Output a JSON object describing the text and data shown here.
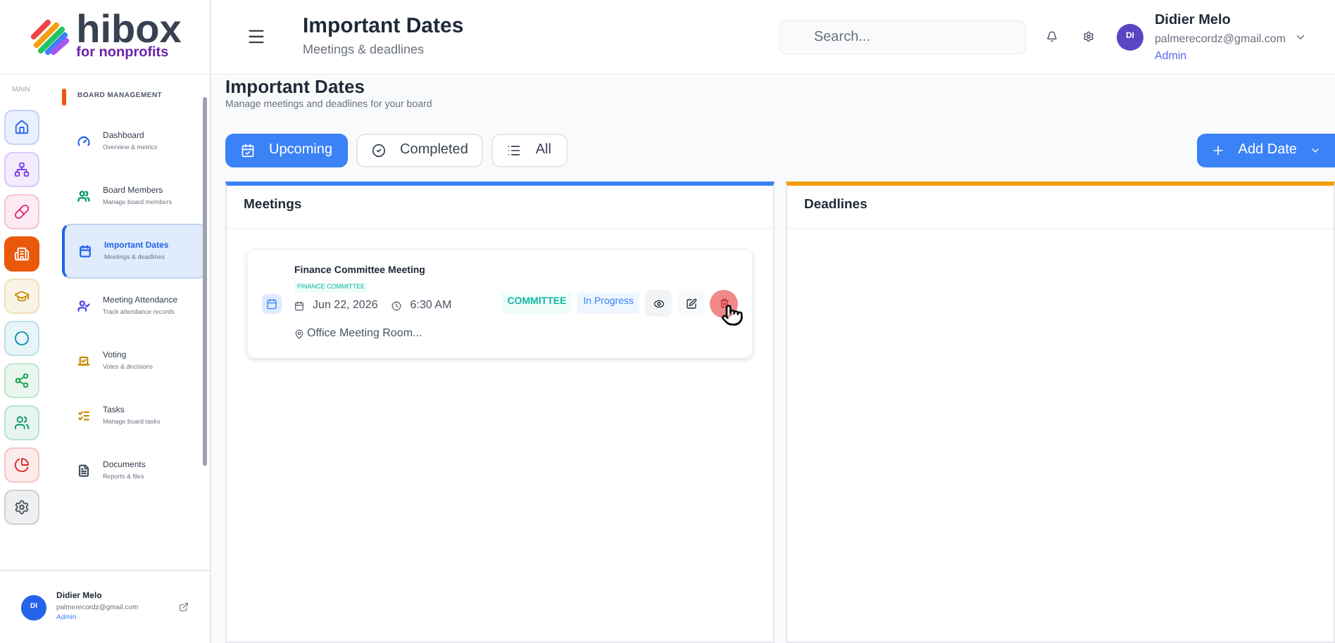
{
  "logo": {
    "name": "hibox",
    "tagline": "for nonprofits"
  },
  "header": {
    "title": "Important Dates",
    "subtitle": "Meetings & deadlines",
    "search": {
      "placeholder": "Search..."
    },
    "user": {
      "initials": "DI",
      "name": "Didier Melo",
      "email": "palmerecordz@gmail.com",
      "role": "Admin"
    }
  },
  "rail": {
    "label": "MAIN",
    "items": [
      {
        "color": "#2563eb",
        "selected": false
      },
      {
        "color": "#7c3aed",
        "selected": false
      },
      {
        "color": "#db2777",
        "selected": false
      },
      {
        "color": "#ea580c",
        "selected": true
      },
      {
        "color": "#ca8a04",
        "selected": false
      },
      {
        "color": "#0891b2",
        "selected": false
      },
      {
        "color": "#16a34a",
        "selected": false
      },
      {
        "color": "#059669",
        "selected": false
      },
      {
        "color": "#dc2626",
        "selected": false
      },
      {
        "color": "#4b5563",
        "selected": false
      }
    ]
  },
  "nav": {
    "section": "BOARD MANAGEMENT",
    "items": [
      {
        "title": "Dashboard",
        "subtitle": "Overview & metrics",
        "color": "#2563eb",
        "selected": false
      },
      {
        "title": "Board Members",
        "subtitle": "Manage board members",
        "color": "#059669",
        "selected": false
      },
      {
        "title": "Important Dates",
        "subtitle": "Meetings & deadlines",
        "color": "#2563eb",
        "selected": true
      },
      {
        "title": "Meeting Attendance",
        "subtitle": "Track attendance records",
        "color": "#4f46e5",
        "selected": false
      },
      {
        "title": "Voting",
        "subtitle": "Votes & decisions",
        "color": "#ca8a04",
        "selected": false
      },
      {
        "title": "Tasks",
        "subtitle": "Manage board tasks",
        "color": "#ca8a04",
        "selected": false
      },
      {
        "title": "Documents",
        "subtitle": "Reports & files",
        "color": "#4b5563",
        "selected": false
      }
    ]
  },
  "sidebar_user": {
    "initials": "DI",
    "name": "Didier Melo",
    "email": "palmerecordz@gmail.com",
    "role": "Admin"
  },
  "page": {
    "title": "Important Dates",
    "subtitle": "Manage meetings and deadlines for your board"
  },
  "filters": [
    {
      "label": "Upcoming",
      "selected": true
    },
    {
      "label": "Completed",
      "selected": false
    },
    {
      "label": "All",
      "selected": false
    }
  ],
  "add_button": "Add Date",
  "panels": [
    {
      "title": "Meetings",
      "color": "#3b82f6",
      "meetings": [
        {
          "title": "Finance Committee Meeting",
          "tag": "FINANCE COMMITTEE",
          "date": "Jun 22, 2026",
          "time": "6:30 AM",
          "location": "Office Meeting Room...",
          "type": "COMMITTEE",
          "status": "In Progress"
        }
      ]
    },
    {
      "title": "Deadlines",
      "color": "#f59e0b"
    }
  ]
}
